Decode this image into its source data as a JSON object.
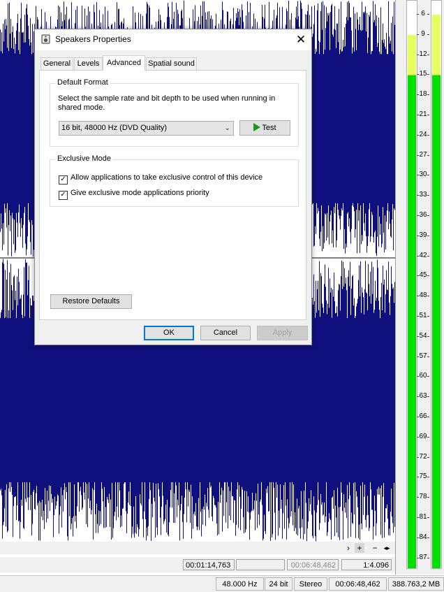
{
  "dialog": {
    "title": "Speakers Properties",
    "close_glyph": "✕",
    "tabs": [
      {
        "label": "General",
        "active": false
      },
      {
        "label": "Levels",
        "active": false
      },
      {
        "label": "Advanced",
        "active": true
      },
      {
        "label": "Spatial sound",
        "active": false
      }
    ],
    "default_format": {
      "group_label": "Default Format",
      "description": "Select the sample rate and bit depth to be used when running in shared mode.",
      "selected_format": "16 bit, 48000 Hz (DVD Quality)",
      "test_label": "Test"
    },
    "exclusive_mode": {
      "group_label": "Exclusive Mode",
      "allow_label": "Allow applications to take exclusive control of this device",
      "allow_checked": true,
      "priority_label": "Give exclusive mode applications priority",
      "priority_checked": true
    },
    "restore_defaults_label": "Restore Defaults",
    "ok_label": "OK",
    "cancel_label": "Cancel",
    "apply_label": "Apply"
  },
  "meter": {
    "scale": [
      "6",
      "9",
      "12",
      "15",
      "18",
      "21",
      "24",
      "27",
      "30",
      "33",
      "36",
      "39",
      "42",
      "45",
      "48",
      "51",
      "54",
      "57",
      "60",
      "63",
      "66",
      "69",
      "72",
      "75",
      "78",
      "81",
      "84",
      "87"
    ],
    "level_left_db": 9,
    "level_right_db": 6,
    "fill_color": "#00e000",
    "peak_color": "#e8ff60"
  },
  "editor": {
    "wave_color": "#0f0f7d",
    "zoom_left_glyph": "›",
    "zoom_plus": "+",
    "zoom_minus": "−",
    "zoom_fit_glyph": "◂▸",
    "position_time": "00:01:14,763",
    "selection_time": "",
    "length_time": "00:06:48,462",
    "zoom_ratio": "1:4.096"
  },
  "status": {
    "sample_rate": "48.000 Hz",
    "bit_depth": "24 bit",
    "channels": "Stereo",
    "duration": "00:06:48,462",
    "size": "388.763,2 MB"
  }
}
